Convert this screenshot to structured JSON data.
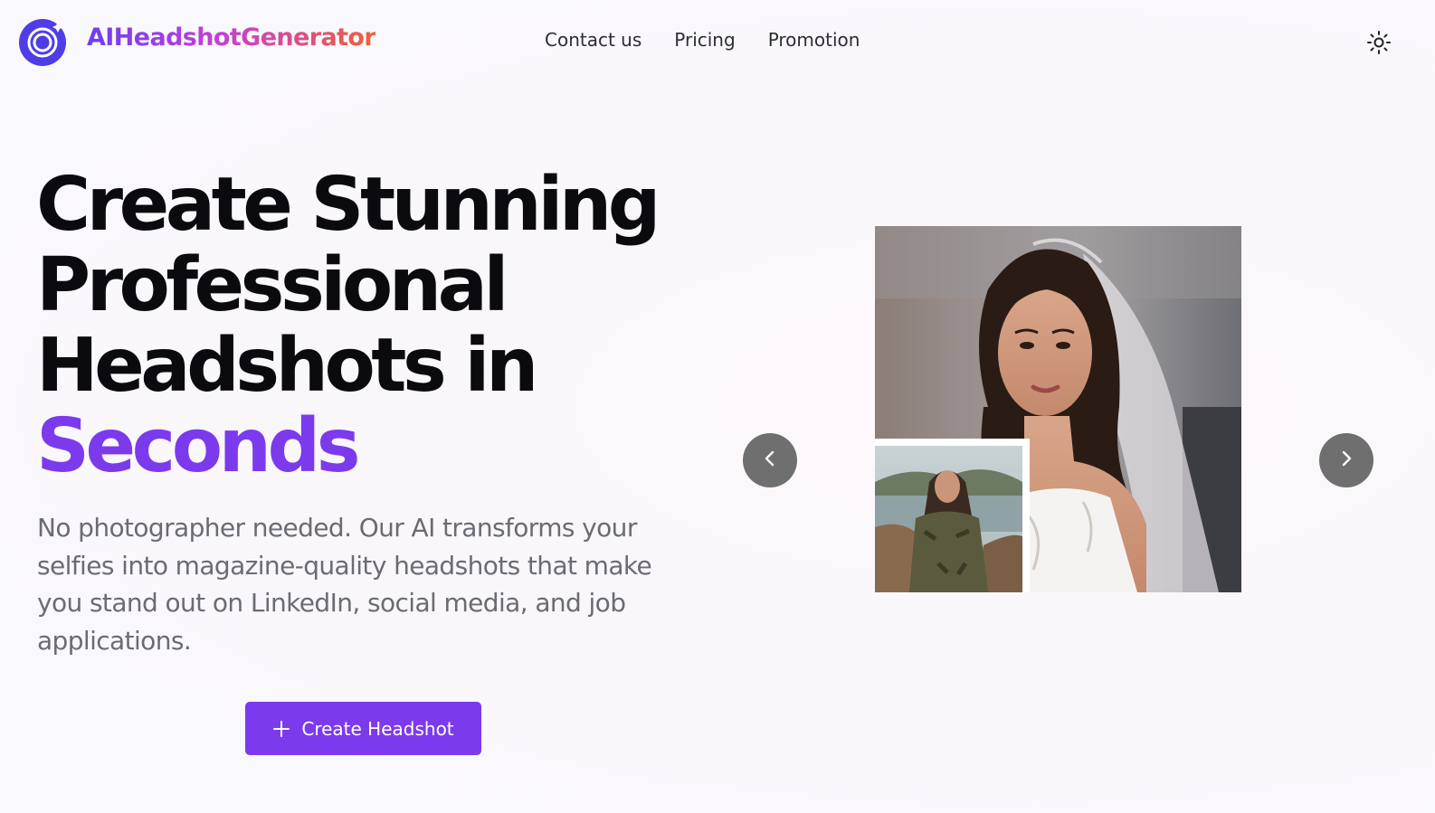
{
  "header": {
    "brand": "AIHeadshotGenerator",
    "nav": [
      "Contact us",
      "Pricing",
      "Promotion"
    ],
    "logo_icon": "aperture-target-icon",
    "theme_icon": "sun-icon"
  },
  "hero": {
    "title_lines": [
      "Create Stunning",
      "Professional",
      "Headshots in"
    ],
    "title_accent": "Seconds",
    "subtitle": "No photographer needed. Our AI transforms your selfies into magazine-quality headshots that make you stand out on LinkedIn, social media, and job applications.",
    "cta_label": "Create Headshot",
    "cta_icon": "plus-icon"
  },
  "carousel": {
    "prev_icon": "chevron-left-icon",
    "next_icon": "chevron-right-icon",
    "main_image": "bride-headshot-photo",
    "inset_image": "selfie-lakeside-photo"
  },
  "colors": {
    "accent": "#7c3aed",
    "brand_gradient": [
      "#6d3df2",
      "#c23fd6",
      "#f0603a"
    ],
    "carousel_button": "#6f6f6f"
  }
}
